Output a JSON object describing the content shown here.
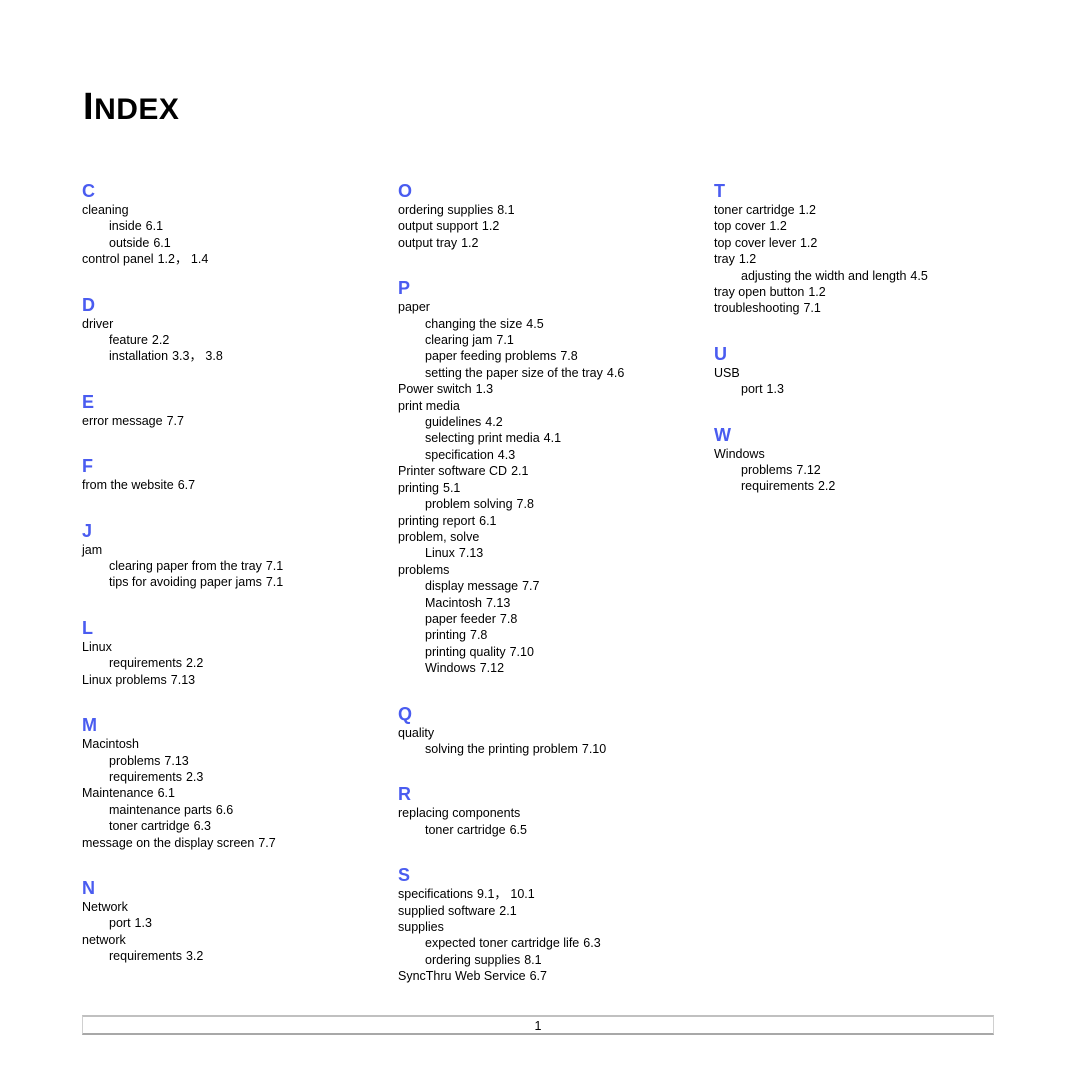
{
  "title": {
    "first": "I",
    "rest": "NDEX"
  },
  "columns": [
    {
      "sections": [
        {
          "letter": "C",
          "entries": [
            {
              "text": "cleaning",
              "level": 0,
              "pages": ""
            },
            {
              "text": "inside",
              "level": 1,
              "pages": "6.1"
            },
            {
              "text": "outside",
              "level": 1,
              "pages": "6.1"
            },
            {
              "text": "control panel",
              "level": 0,
              "pages": "1.2， 1.4"
            }
          ]
        },
        {
          "letter": "D",
          "entries": [
            {
              "text": "driver",
              "level": 0,
              "pages": ""
            },
            {
              "text": "feature",
              "level": 1,
              "pages": "2.2"
            },
            {
              "text": "installation",
              "level": 1,
              "pages": "3.3， 3.8"
            }
          ]
        },
        {
          "letter": "E",
          "entries": [
            {
              "text": "error message",
              "level": 0,
              "pages": "7.7"
            }
          ]
        },
        {
          "letter": "F",
          "entries": [
            {
              "text": "from the website",
              "level": 0,
              "pages": "6.7"
            }
          ]
        },
        {
          "letter": "J",
          "entries": [
            {
              "text": "jam",
              "level": 0,
              "pages": ""
            },
            {
              "text": "clearing paper from the tray",
              "level": 1,
              "pages": "7.1"
            },
            {
              "text": "tips for avoiding paper jams",
              "level": 1,
              "pages": "7.1"
            }
          ]
        },
        {
          "letter": "L",
          "entries": [
            {
              "text": "Linux",
              "level": 0,
              "pages": ""
            },
            {
              "text": "requirements",
              "level": 1,
              "pages": "2.2"
            },
            {
              "text": "Linux problems",
              "level": 0,
              "pages": "7.13"
            }
          ]
        },
        {
          "letter": "M",
          "entries": [
            {
              "text": "Macintosh",
              "level": 0,
              "pages": ""
            },
            {
              "text": "problems",
              "level": 1,
              "pages": "7.13"
            },
            {
              "text": "requirements",
              "level": 1,
              "pages": "2.3"
            },
            {
              "text": "Maintenance",
              "level": 0,
              "pages": "6.1"
            },
            {
              "text": "maintenance parts",
              "level": 1,
              "pages": "6.6"
            },
            {
              "text": "toner cartridge",
              "level": 1,
              "pages": "6.3"
            },
            {
              "text": "message on the display screen",
              "level": 0,
              "pages": "7.7"
            }
          ]
        },
        {
          "letter": "N",
          "entries": [
            {
              "text": "Network",
              "level": 0,
              "pages": ""
            },
            {
              "text": "port",
              "level": 1,
              "pages": "1.3"
            },
            {
              "text": "network",
              "level": 0,
              "pages": ""
            },
            {
              "text": "requirements",
              "level": 1,
              "pages": "3.2"
            }
          ]
        }
      ]
    },
    {
      "sections": [
        {
          "letter": "O",
          "entries": [
            {
              "text": "ordering supplies",
              "level": 0,
              "pages": "8.1"
            },
            {
              "text": "output support",
              "level": 0,
              "pages": "1.2"
            },
            {
              "text": "output tray",
              "level": 0,
              "pages": "1.2"
            }
          ]
        },
        {
          "letter": "P",
          "entries": [
            {
              "text": "paper",
              "level": 0,
              "pages": ""
            },
            {
              "text": "changing the size",
              "level": 1,
              "pages": "4.5"
            },
            {
              "text": "clearing jam",
              "level": 1,
              "pages": "7.1"
            },
            {
              "text": "paper feeding problems",
              "level": 1,
              "pages": "7.8"
            },
            {
              "text": "setting the paper size of the tray",
              "level": 1,
              "pages": "4.6"
            },
            {
              "text": "Power switch",
              "level": 0,
              "pages": "1.3"
            },
            {
              "text": "print media",
              "level": 0,
              "pages": ""
            },
            {
              "text": "guidelines",
              "level": 1,
              "pages": "4.2"
            },
            {
              "text": "selecting print media",
              "level": 1,
              "pages": "4.1"
            },
            {
              "text": "specification",
              "level": 1,
              "pages": "4.3"
            },
            {
              "text": "Printer software CD",
              "level": 0,
              "pages": "2.1"
            },
            {
              "text": "printing",
              "level": 0,
              "pages": "5.1"
            },
            {
              "text": "problem solving",
              "level": 1,
              "pages": "7.8"
            },
            {
              "text": "printing report",
              "level": 0,
              "pages": "6.1"
            },
            {
              "text": "problem, solve",
              "level": 0,
              "pages": ""
            },
            {
              "text": "Linux",
              "level": 1,
              "pages": "7.13"
            },
            {
              "text": "problems",
              "level": 0,
              "pages": ""
            },
            {
              "text": "display message",
              "level": 1,
              "pages": "7.7"
            },
            {
              "text": "Macintosh",
              "level": 1,
              "pages": "7.13"
            },
            {
              "text": "paper feeder",
              "level": 1,
              "pages": "7.8"
            },
            {
              "text": "printing",
              "level": 1,
              "pages": "7.8"
            },
            {
              "text": "printing quality",
              "level": 1,
              "pages": "7.10"
            },
            {
              "text": "Windows",
              "level": 1,
              "pages": "7.12"
            }
          ]
        },
        {
          "letter": "Q",
          "entries": [
            {
              "text": "quality",
              "level": 0,
              "pages": ""
            },
            {
              "text": "solving the printing problem",
              "level": 1,
              "pages": "7.10"
            }
          ]
        },
        {
          "letter": "R",
          "entries": [
            {
              "text": "replacing components",
              "level": 0,
              "pages": ""
            },
            {
              "text": "toner cartridge",
              "level": 1,
              "pages": "6.5"
            }
          ]
        },
        {
          "letter": "S",
          "entries": [
            {
              "text": "specifications",
              "level": 0,
              "pages": "9.1， 10.1"
            },
            {
              "text": "supplied software",
              "level": 0,
              "pages": "2.1"
            },
            {
              "text": "supplies",
              "level": 0,
              "pages": ""
            },
            {
              "text": "expected toner cartridge life",
              "level": 1,
              "pages": "6.3"
            },
            {
              "text": "ordering supplies",
              "level": 1,
              "pages": "8.1"
            },
            {
              "text": "SyncThru Web Service",
              "level": 0,
              "pages": "6.7"
            }
          ]
        }
      ]
    },
    {
      "sections": [
        {
          "letter": "T",
          "entries": [
            {
              "text": "toner cartridge",
              "level": 0,
              "pages": "1.2"
            },
            {
              "text": "top cover",
              "level": 0,
              "pages": "1.2"
            },
            {
              "text": "top cover lever",
              "level": 0,
              "pages": "1.2"
            },
            {
              "text": "tray",
              "level": 0,
              "pages": "1.2"
            },
            {
              "text": "adjusting the width and length",
              "level": 1,
              "pages": "4.5"
            },
            {
              "text": "tray open button",
              "level": 0,
              "pages": "1.2"
            },
            {
              "text": "troubleshooting",
              "level": 0,
              "pages": "7.1"
            }
          ]
        },
        {
          "letter": "U",
          "entries": [
            {
              "text": "USB",
              "level": 0,
              "pages": ""
            },
            {
              "text": "port",
              "level": 1,
              "pages": "1.3"
            }
          ]
        },
        {
          "letter": "W",
          "entries": [
            {
              "text": "Windows",
              "level": 0,
              "pages": ""
            },
            {
              "text": "problems",
              "level": 1,
              "pages": "7.12"
            },
            {
              "text": "requirements",
              "level": 1,
              "pages": "2.2"
            }
          ]
        }
      ]
    }
  ],
  "footer": {
    "page_number": "1"
  },
  "colors": {
    "letter_heading": "#4a5cf0",
    "text": "#000000"
  }
}
